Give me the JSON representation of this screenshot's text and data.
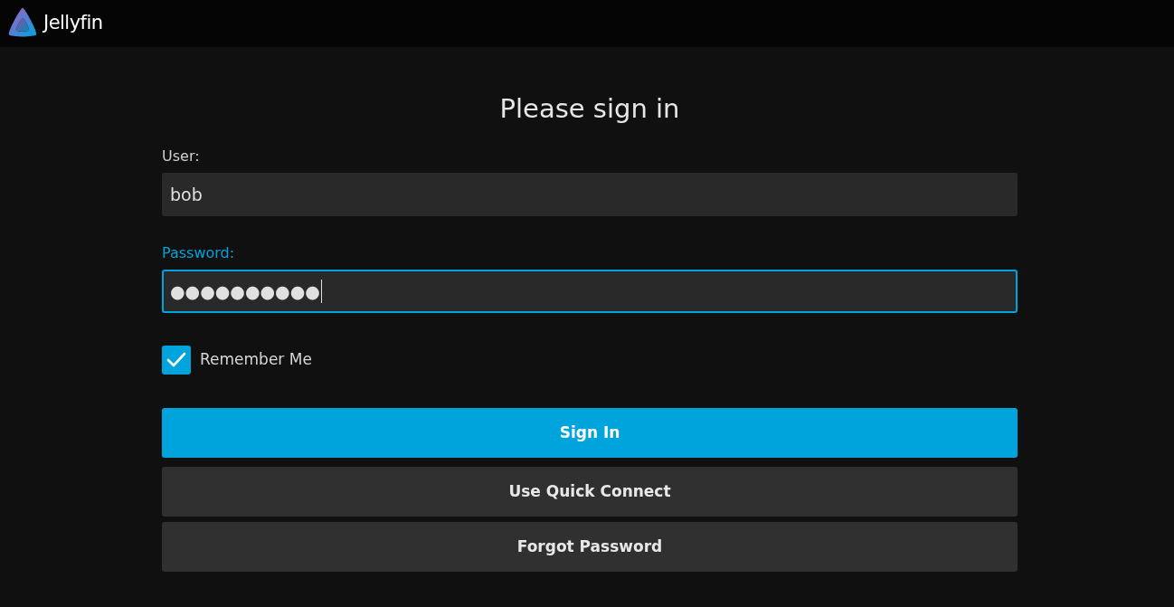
{
  "header": {
    "logo_text": "Jellyfin"
  },
  "title": "Please sign in",
  "fields": [
    {
      "label": "User:",
      "value": "bob",
      "focused": false
    },
    {
      "label": "Password:",
      "value": "●●●●●●●●●●",
      "focused": true
    }
  ],
  "remember_me": {
    "label": "Remember Me",
    "checked": true
  },
  "buttons": [
    {
      "label": "Sign In",
      "kind": "primary"
    },
    {
      "label": "Use Quick Connect",
      "kind": "secondary"
    },
    {
      "label": "Forgot Password",
      "kind": "secondary"
    }
  ]
}
